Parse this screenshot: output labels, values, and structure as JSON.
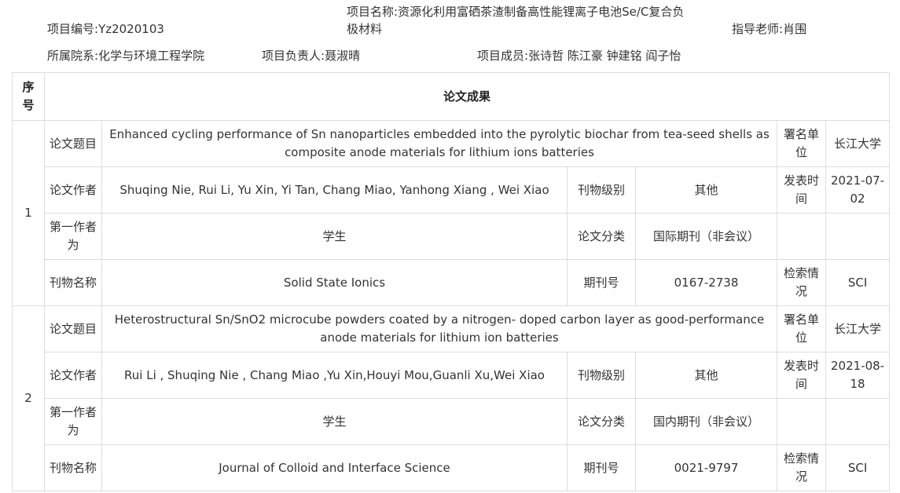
{
  "project": {
    "id_label": "项目编号:",
    "id_value": "Yz2020103",
    "name_label": "项目名称:",
    "name_value_line1": "资源化利用富硒茶渣制备高性能锂离子电池Se/C复合负",
    "name_value_line2": "极材料",
    "advisor_label": "指导老师:",
    "advisor_value": "肖围",
    "dept_label": "所属院系:",
    "dept_value": "化学与环境工程学院",
    "leader_label": "项目负责人:",
    "leader_value": "聂淑晴",
    "members_label": "项目成员:",
    "members_value": "张诗哲 陈江豪 钟建铭 阎子怡"
  },
  "table": {
    "col_index": "序号",
    "col_results": "论文成果",
    "rows": [
      {
        "index": "1",
        "title_label": "论文题目",
        "title": "Enhanced cycling performance of Sn nanoparticles embedded into the pyrolytic biochar from tea-seed shells as composite anode materials for lithium ions batteries",
        "affil_label": "署名单位",
        "affil": "长江大学",
        "authors_label": "论文作者",
        "authors": "Shuqing Nie, Rui Li, Yu Xin, Yi Tan, Chang Miao, Yanhong Xiang , Wei Xiao",
        "level_label": "刊物级别",
        "level": "其他",
        "date_label": "发表时间",
        "date": "2021-07-02",
        "first_label": "第一作者为",
        "first": "学生",
        "category_label": "论文分类",
        "category": "国际期刊（非会议）",
        "journal_label": "刊物名称",
        "journal": "Solid State Ionics",
        "issn_label": "期刊号",
        "issn": "0167-2738",
        "index_status_label": "检索情况",
        "index_status": "SCI"
      },
      {
        "index": "2",
        "title_label": "论文题目",
        "title": "Heterostructural Sn/SnO2 microcube powders coated by a nitrogen- doped carbon layer as good-performance anode materials for lithium ion batteries",
        "affil_label": "署名单位",
        "affil": "长江大学",
        "authors_label": "论文作者",
        "authors": "Rui Li , Shuqing Nie , Chang Miao ,Yu Xin,Houyi Mou,Guanli Xu,Wei Xiao",
        "level_label": "刊物级别",
        "level": "其他",
        "date_label": "发表时间",
        "date": "2021-08-18",
        "first_label": "第一作者为",
        "first": "学生",
        "category_label": "论文分类",
        "category": "国内期刊（非会议）",
        "journal_label": "刊物名称",
        "journal": "Journal of Colloid and Interface Science",
        "issn_label": "期刊号",
        "issn": "0021-9797",
        "index_status_label": "检索情况",
        "index_status": "SCI"
      }
    ]
  }
}
